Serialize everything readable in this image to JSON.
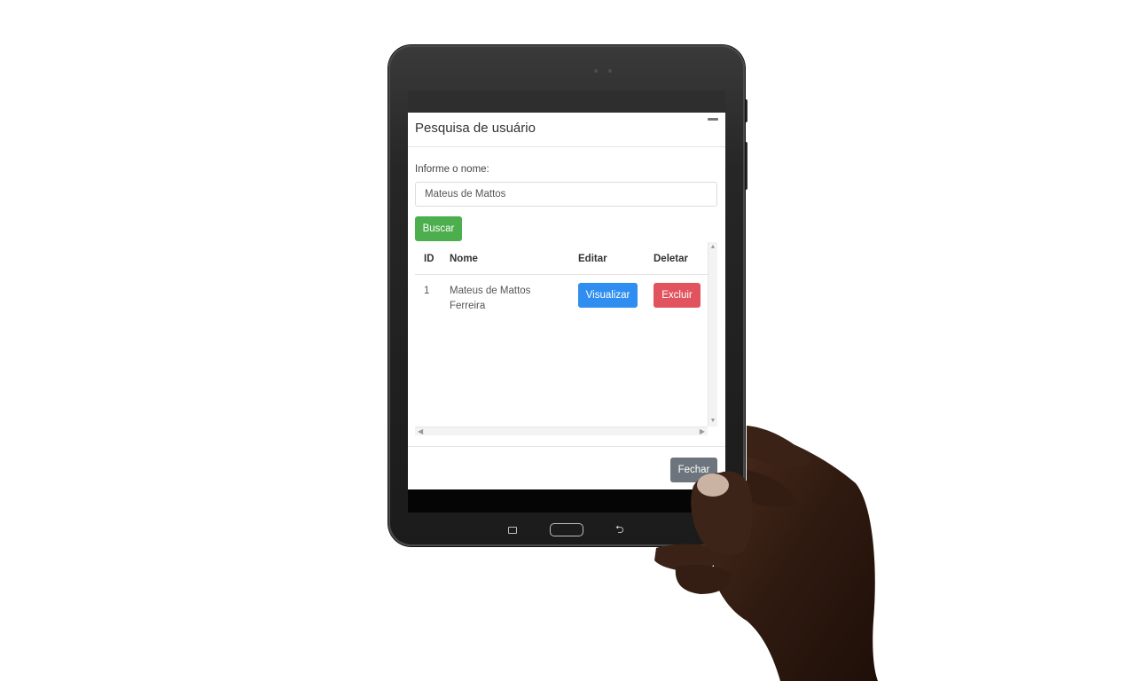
{
  "modal": {
    "title": "Pesquisa de usuário",
    "name_label": "Informe o nome:",
    "name_value": "Mateus de Mattos",
    "search_label": "Buscar",
    "close_label": "Fechar"
  },
  "table": {
    "headers": [
      "ID",
      "Nome",
      "Editar",
      "Deletar"
    ],
    "rows": [
      {
        "id": "1",
        "name": "Mateus de Mattos Ferreira",
        "edit_label": "Visualizar",
        "delete_label": "Excluir"
      }
    ]
  },
  "device": {
    "back_glyph": "⮌"
  },
  "colors": {
    "search_button": "#4cae4c",
    "view_button": "#2f8ef0",
    "delete_button": "#e1545f",
    "close_button": "#6c757d"
  }
}
